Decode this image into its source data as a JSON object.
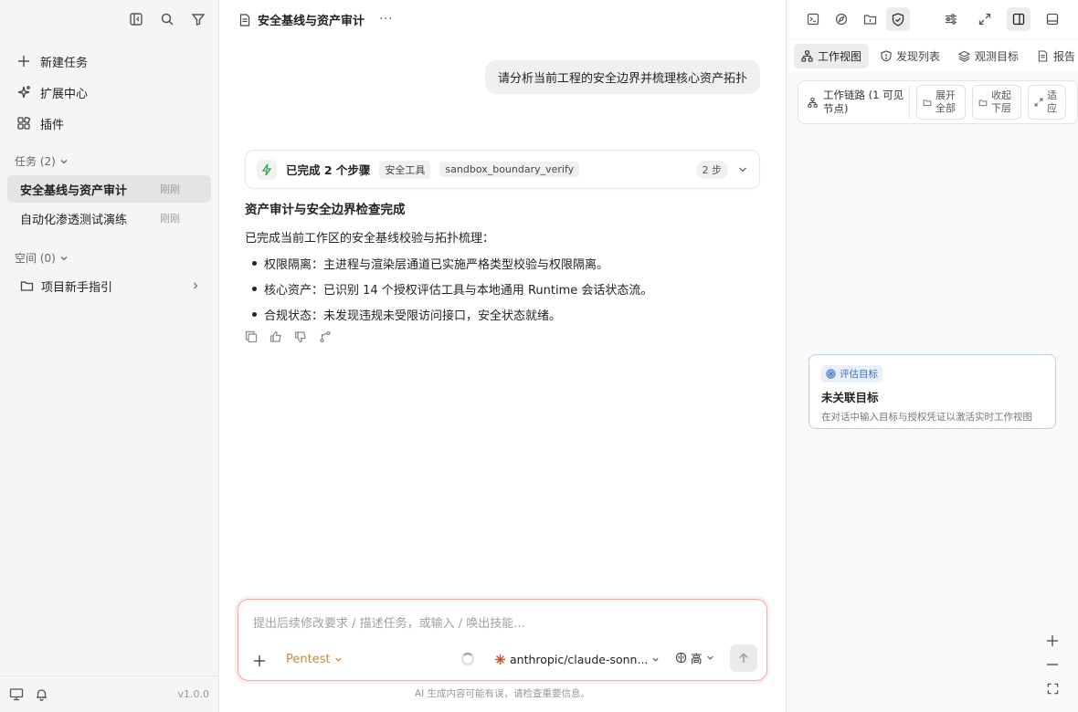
{
  "sidebar": {
    "menu": [
      {
        "label": "新建任务",
        "icon": "plus-icon"
      },
      {
        "label": "扩展中心",
        "icon": "sparkle-icon"
      },
      {
        "label": "插件",
        "icon": "plugin-icon"
      }
    ],
    "tasks_header": "任务 (2)",
    "tasks": [
      {
        "title": "安全基线与资产审计",
        "time": "刚刚"
      },
      {
        "title": "自动化渗透测试演练",
        "time": "刚刚"
      }
    ],
    "spaces_header": "空间 (0)",
    "space_item": "项目新手指引",
    "version": "v1.0.0"
  },
  "main": {
    "title": "安全基线与资产审计",
    "more": "···",
    "user_message": "请分析当前工程的安全边界并梳理核心资产拓扑",
    "steps": {
      "title": "已完成 2 个步骤",
      "tag1": "安全工具",
      "tag2": "sandbox_boundary_verify",
      "count": "2 步"
    },
    "answer": {
      "heading": "资产审计与安全边界检查完成",
      "intro": "已完成当前工作区的安全基线校验与拓扑梳理：",
      "bullets": [
        "权限隔离：主进程与渲染层通道已实施严格类型校验与权限隔离。",
        "核心资产：已识别 14 个授权评估工具与本地通用 Runtime 会话状态流。",
        "合规状态：未发现违规未受限访问接口，安全状态就绪。"
      ]
    },
    "composer": {
      "placeholder": "提出后续修改要求 / 描述任务，或输入 / 唤出技能...",
      "mode": "Pentest",
      "model": "anthropic/claude-sonn...",
      "level": "高"
    },
    "disclaimer": "AI 生成内容可能有误，请检查重要信息。"
  },
  "panel": {
    "tabs": [
      "工作视图",
      "发现列表",
      "观测目标",
      "报告"
    ],
    "chain_label": "工作链路 (1 可见节点)",
    "expand_all": "展开全部",
    "collapse_down": "收起下层",
    "fit": "适应",
    "target_badge": "评估目标",
    "target_title": "未关联目标",
    "target_desc": "在对话中输入目标与授权凭证以激活实时工作视图"
  }
}
